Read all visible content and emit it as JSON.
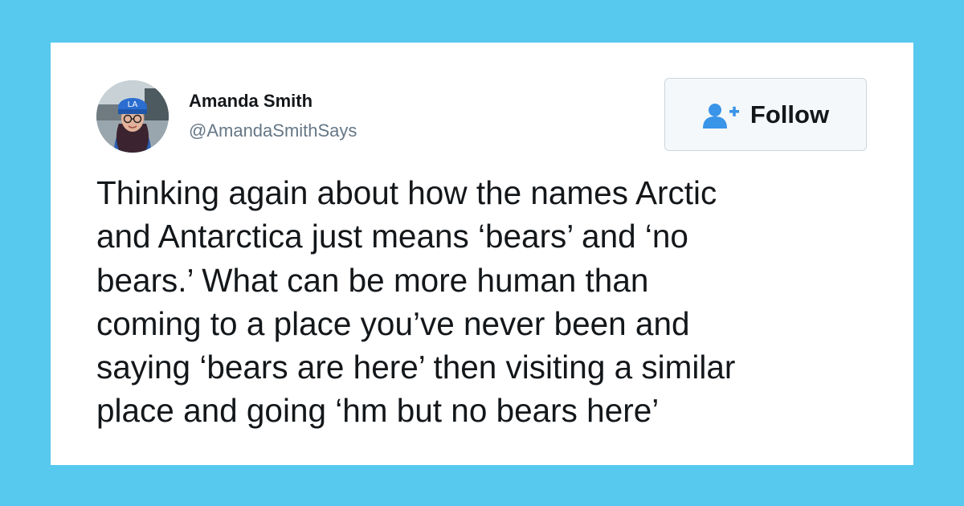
{
  "tweet": {
    "author": {
      "display_name": "Amanda Smith",
      "handle": "@AmandaSmithSays",
      "avatar_icon": "profile-photo"
    },
    "follow_button": {
      "label": "Follow",
      "icon": "add-user-icon",
      "icon_color": "#3a94e8"
    },
    "text": "Thinking again about how the names Arctic\nand Antarctica just means ‘bears’ and ‘no\nbears.’ What can be more human than\ncoming to a place you’ve never been and\nsaying ‘bears are here’ then visiting a similar\nplace and going ‘hm but no bears here’"
  },
  "colors": {
    "background": "#57c8ee",
    "card": "#ffffff",
    "text": "#14171a",
    "handle": "#657786",
    "button_border": "#ccd6dd"
  }
}
